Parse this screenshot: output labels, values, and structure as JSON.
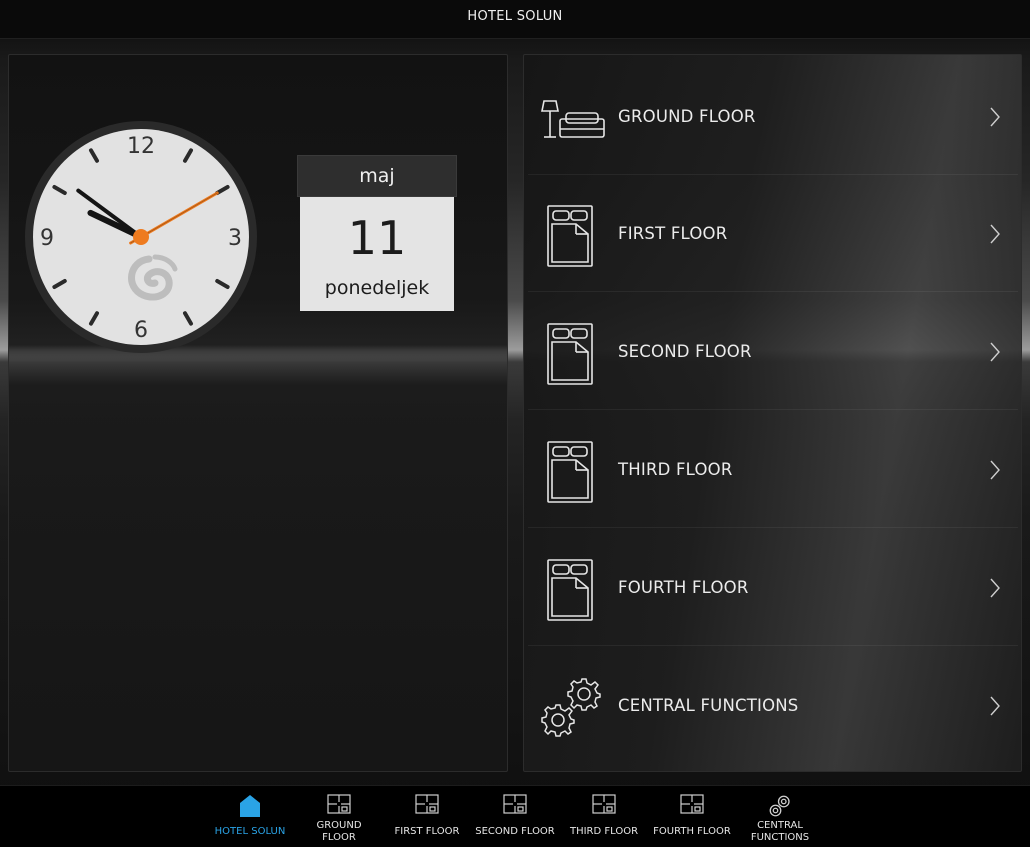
{
  "header": {
    "title": "HOTEL SOLUN"
  },
  "clock": {
    "numbers": [
      "12",
      "3",
      "6",
      "9"
    ],
    "time": {
      "hour": 9,
      "minute": 51,
      "second": 5
    },
    "colors": {
      "face": "#e2e2e2",
      "rim": "#2a2a2a",
      "hand": "#141414",
      "accent": "#ee7b1f"
    }
  },
  "calendar": {
    "month": "maj",
    "day": "11",
    "weekday": "ponedeljek"
  },
  "menu": {
    "items": [
      {
        "label": "GROUND FLOOR",
        "icon": "sofa-lamp-icon"
      },
      {
        "label": "FIRST FLOOR",
        "icon": "bed-icon"
      },
      {
        "label": "SECOND FLOOR",
        "icon": "bed-icon"
      },
      {
        "label": "THIRD FLOOR",
        "icon": "bed-icon"
      },
      {
        "label": "FOURTH FLOOR",
        "icon": "bed-icon"
      },
      {
        "label": "CENTRAL FUNCTIONS",
        "icon": "gears-icon"
      }
    ]
  },
  "bottomnav": {
    "items": [
      {
        "label": "HOTEL SOLUN",
        "icon": "home-icon",
        "active": true
      },
      {
        "label_line1": "GROUND",
        "label_line2": "FLOOR",
        "icon": "floorplan-icon"
      },
      {
        "label": "FIRST FLOOR",
        "icon": "floorplan-icon"
      },
      {
        "label": "SECOND FLOOR",
        "icon": "floorplan-icon"
      },
      {
        "label": "THIRD FLOOR",
        "icon": "floorplan-icon"
      },
      {
        "label": "FOURTH FLOOR",
        "icon": "floorplan-icon"
      },
      {
        "label_line1": "CENTRAL",
        "label_line2": "FUNCTIONS",
        "icon": "gears-icon"
      }
    ],
    "accent_color": "#2aa3e6"
  }
}
